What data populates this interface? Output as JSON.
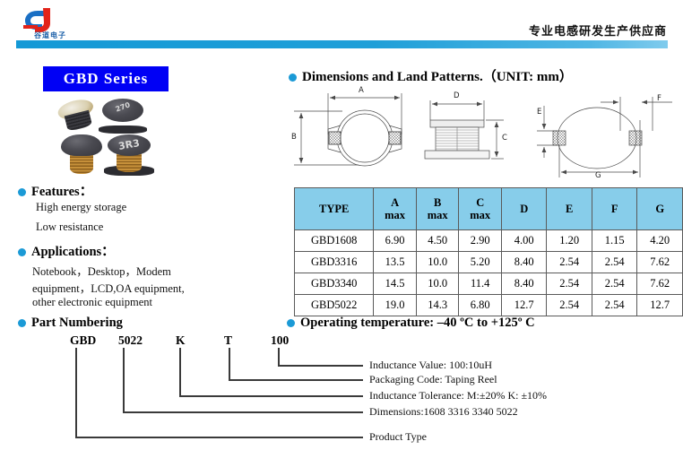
{
  "header": {
    "logo_letter": "G",
    "logo_company_cn": "谷道电子",
    "slogan_cn": "专业电感研发生产供应商"
  },
  "left": {
    "series_title": "GBD    Series",
    "product_photo_marks": [
      "270",
      "3R3"
    ],
    "features": {
      "heading": "Features：",
      "items": [
        "High energy storage",
        "Low resistance"
      ]
    },
    "applications": {
      "heading": "Applications：",
      "lines": [
        "Notebook，Desktop，Modem",
        "equipment，LCD,OA equipment,",
        "other electronic equipment"
      ]
    },
    "part_numbering_heading": "Part Numbering"
  },
  "dimensions": {
    "heading": "Dimensions and Land Patterns.（UNIT: mm）",
    "drawing_labels": [
      "A",
      "B",
      "C",
      "D",
      "E",
      "F",
      "G"
    ]
  },
  "table": {
    "columns": [
      {
        "label": "TYPE",
        "sub": ""
      },
      {
        "label": "A",
        "sub": "max"
      },
      {
        "label": "B",
        "sub": "max"
      },
      {
        "label": "C",
        "sub": "max"
      },
      {
        "label": "D",
        "sub": ""
      },
      {
        "label": "E",
        "sub": ""
      },
      {
        "label": "F",
        "sub": ""
      },
      {
        "label": "G",
        "sub": ""
      }
    ],
    "rows": [
      [
        "GBD1608",
        "6.90",
        "4.50",
        "2.90",
        "4.00",
        "1.20",
        "1.15",
        "4.20"
      ],
      [
        "GBD3316",
        "13.5",
        "10.0",
        "5.20",
        "8.40",
        "2.54",
        "2.54",
        "7.62"
      ],
      [
        "GBD3340",
        "14.5",
        "10.0",
        "11.4",
        "8.40",
        "2.54",
        "2.54",
        "7.62"
      ],
      [
        "GBD5022",
        "19.0",
        "14.3",
        "6.80",
        "12.7",
        "2.54",
        "2.54",
        "12.7"
      ]
    ]
  },
  "operating": {
    "heading": "Operating temperature: –40 ºC to +125º C"
  },
  "part_number": {
    "code_parts": [
      "GBD",
      "5022",
      "K",
      "T",
      "100"
    ],
    "legend": [
      "Inductance Value:    100:10uH",
      "Packaging Code: Taping Reel",
      "Inductance Tolerance: M:±20% K:  ±10%",
      "Dimensions:1608 3316 3340 5022",
      "Product Type"
    ]
  },
  "colors": {
    "brand_blue": "#1b9ad6",
    "series_box": "#0000f5",
    "table_header": "#87cdea",
    "logo_red": "#e2231a"
  }
}
